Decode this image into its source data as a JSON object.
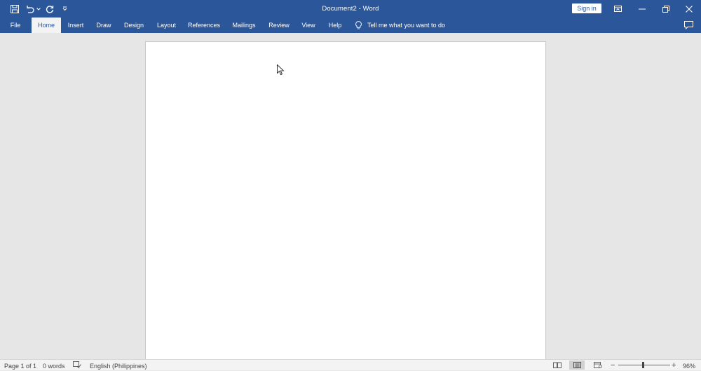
{
  "titlebar": {
    "title": "Document2  -  Word",
    "sign_in_label": "Sign in"
  },
  "ribbon": {
    "tabs": [
      {
        "label": "File"
      },
      {
        "label": "Home"
      },
      {
        "label": "Insert"
      },
      {
        "label": "Draw"
      },
      {
        "label": "Design"
      },
      {
        "label": "Layout"
      },
      {
        "label": "References"
      },
      {
        "label": "Mailings"
      },
      {
        "label": "Review"
      },
      {
        "label": "View"
      },
      {
        "label": "Help"
      }
    ],
    "active_tab": "Home",
    "tell_me": "Tell me what you want to do"
  },
  "statusbar": {
    "page_info": "Page 1 of 1",
    "word_count": "0 words",
    "language": "English (Philippines)",
    "zoom_percent": "96%",
    "zoom_level": 96
  },
  "colors": {
    "accent": "#2b579a",
    "workspace": "#e6e6e6",
    "statusbar": "#f3f3f3"
  }
}
